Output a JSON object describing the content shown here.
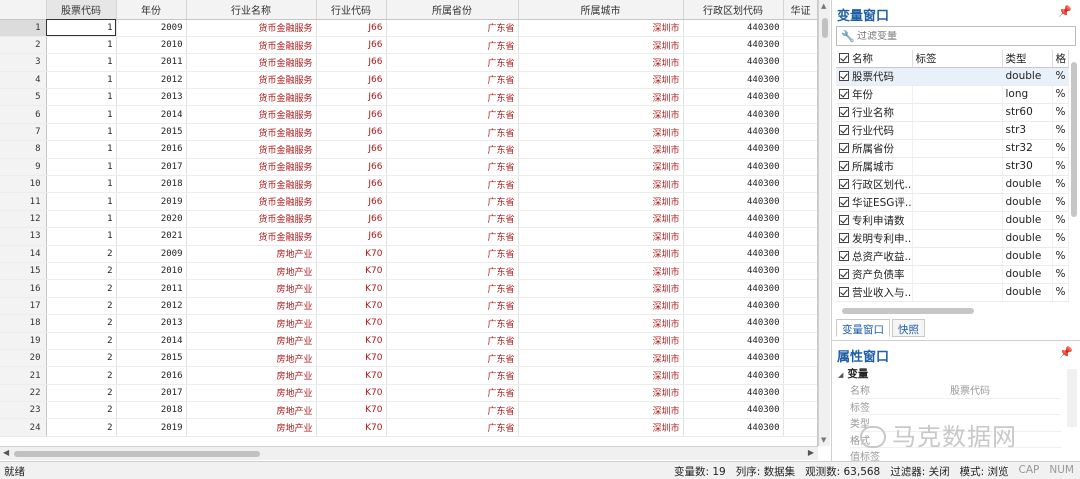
{
  "grid": {
    "columns": [
      "股票代码",
      "年份",
      "行业名称",
      "行业代码",
      "所属省份",
      "所属城市",
      "行政区划代码",
      "华证"
    ],
    "rows": [
      [
        "1",
        "1",
        "2009",
        "货币金融服务",
        "J66",
        "广东省",
        "深圳市",
        "440300"
      ],
      [
        "2",
        "1",
        "2010",
        "货币金融服务",
        "J66",
        "广东省",
        "深圳市",
        "440300"
      ],
      [
        "3",
        "1",
        "2011",
        "货币金融服务",
        "J66",
        "广东省",
        "深圳市",
        "440300"
      ],
      [
        "4",
        "1",
        "2012",
        "货币金融服务",
        "J66",
        "广东省",
        "深圳市",
        "440300"
      ],
      [
        "5",
        "1",
        "2013",
        "货币金融服务",
        "J66",
        "广东省",
        "深圳市",
        "440300"
      ],
      [
        "6",
        "1",
        "2014",
        "货币金融服务",
        "J66",
        "广东省",
        "深圳市",
        "440300"
      ],
      [
        "7",
        "1",
        "2015",
        "货币金融服务",
        "J66",
        "广东省",
        "深圳市",
        "440300"
      ],
      [
        "8",
        "1",
        "2016",
        "货币金融服务",
        "J66",
        "广东省",
        "深圳市",
        "440300"
      ],
      [
        "9",
        "1",
        "2017",
        "货币金融服务",
        "J66",
        "广东省",
        "深圳市",
        "440300"
      ],
      [
        "10",
        "1",
        "2018",
        "货币金融服务",
        "J66",
        "广东省",
        "深圳市",
        "440300"
      ],
      [
        "11",
        "1",
        "2019",
        "货币金融服务",
        "J66",
        "广东省",
        "深圳市",
        "440300"
      ],
      [
        "12",
        "1",
        "2020",
        "货币金融服务",
        "J66",
        "广东省",
        "深圳市",
        "440300"
      ],
      [
        "13",
        "1",
        "2021",
        "货币金融服务",
        "J66",
        "广东省",
        "深圳市",
        "440300"
      ],
      [
        "14",
        "2",
        "2009",
        "房地产业",
        "K70",
        "广东省",
        "深圳市",
        "440300"
      ],
      [
        "15",
        "2",
        "2010",
        "房地产业",
        "K70",
        "广东省",
        "深圳市",
        "440300"
      ],
      [
        "16",
        "2",
        "2011",
        "房地产业",
        "K70",
        "广东省",
        "深圳市",
        "440300"
      ],
      [
        "17",
        "2",
        "2012",
        "房地产业",
        "K70",
        "广东省",
        "深圳市",
        "440300"
      ],
      [
        "18",
        "2",
        "2013",
        "房地产业",
        "K70",
        "广东省",
        "深圳市",
        "440300"
      ],
      [
        "19",
        "2",
        "2014",
        "房地产业",
        "K70",
        "广东省",
        "深圳市",
        "440300"
      ],
      [
        "20",
        "2",
        "2015",
        "房地产业",
        "K70",
        "广东省",
        "深圳市",
        "440300"
      ],
      [
        "21",
        "2",
        "2016",
        "房地产业",
        "K70",
        "广东省",
        "深圳市",
        "440300"
      ],
      [
        "22",
        "2",
        "2017",
        "房地产业",
        "K70",
        "广东省",
        "深圳市",
        "440300"
      ],
      [
        "23",
        "2",
        "2018",
        "房地产业",
        "K70",
        "广东省",
        "深圳市",
        "440300"
      ],
      [
        "24",
        "2",
        "2019",
        "房地产业",
        "K70",
        "广东省",
        "深圳市",
        "440300"
      ]
    ]
  },
  "variables": {
    "title": "变量窗口",
    "filter_placeholder": "过滤变量",
    "headers": [
      "名称",
      "标签",
      "类型",
      "格"
    ],
    "items": [
      {
        "name": "股票代码",
        "type": "double",
        "fmt": "%"
      },
      {
        "name": "年份",
        "type": "long",
        "fmt": "%"
      },
      {
        "name": "行业名称",
        "type": "str60",
        "fmt": "%"
      },
      {
        "name": "行业代码",
        "type": "str3",
        "fmt": "%"
      },
      {
        "name": "所属省份",
        "type": "str32",
        "fmt": "%"
      },
      {
        "name": "所属城市",
        "type": "str30",
        "fmt": "%"
      },
      {
        "name": "行政区划代...",
        "type": "double",
        "fmt": "%"
      },
      {
        "name": "华证ESG评...",
        "type": "double",
        "fmt": "%"
      },
      {
        "name": "专利申请数",
        "type": "double",
        "fmt": "%"
      },
      {
        "name": "发明专利申...",
        "type": "double",
        "fmt": "%"
      },
      {
        "name": "总资产收益...",
        "type": "double",
        "fmt": "%"
      },
      {
        "name": "资产负债率",
        "type": "double",
        "fmt": "%"
      },
      {
        "name": "营业收入与...",
        "type": "double",
        "fmt": "%"
      }
    ],
    "tabs": [
      "变量窗口",
      "快照"
    ]
  },
  "properties": {
    "title": "属性窗口",
    "group": "变量",
    "rows": [
      {
        "k": "名称",
        "v": "股票代码"
      },
      {
        "k": "标签",
        "v": ""
      },
      {
        "k": "类型",
        "v": ""
      },
      {
        "k": "格式",
        "v": ""
      },
      {
        "k": "值标签",
        "v": ""
      }
    ]
  },
  "watermark": "马克数据网",
  "status": {
    "left": "就绪",
    "var_count": "变量数: 19",
    "sort": "列序: 数据集",
    "obs": "观测数: 63,568",
    "filter": "过滤器: 关闭",
    "mode": "模式: 浏览",
    "cap": "CAP",
    "num": "NUM"
  },
  "colors": {
    "accent": "#1e5fa8",
    "string_cell": "#b01818"
  }
}
